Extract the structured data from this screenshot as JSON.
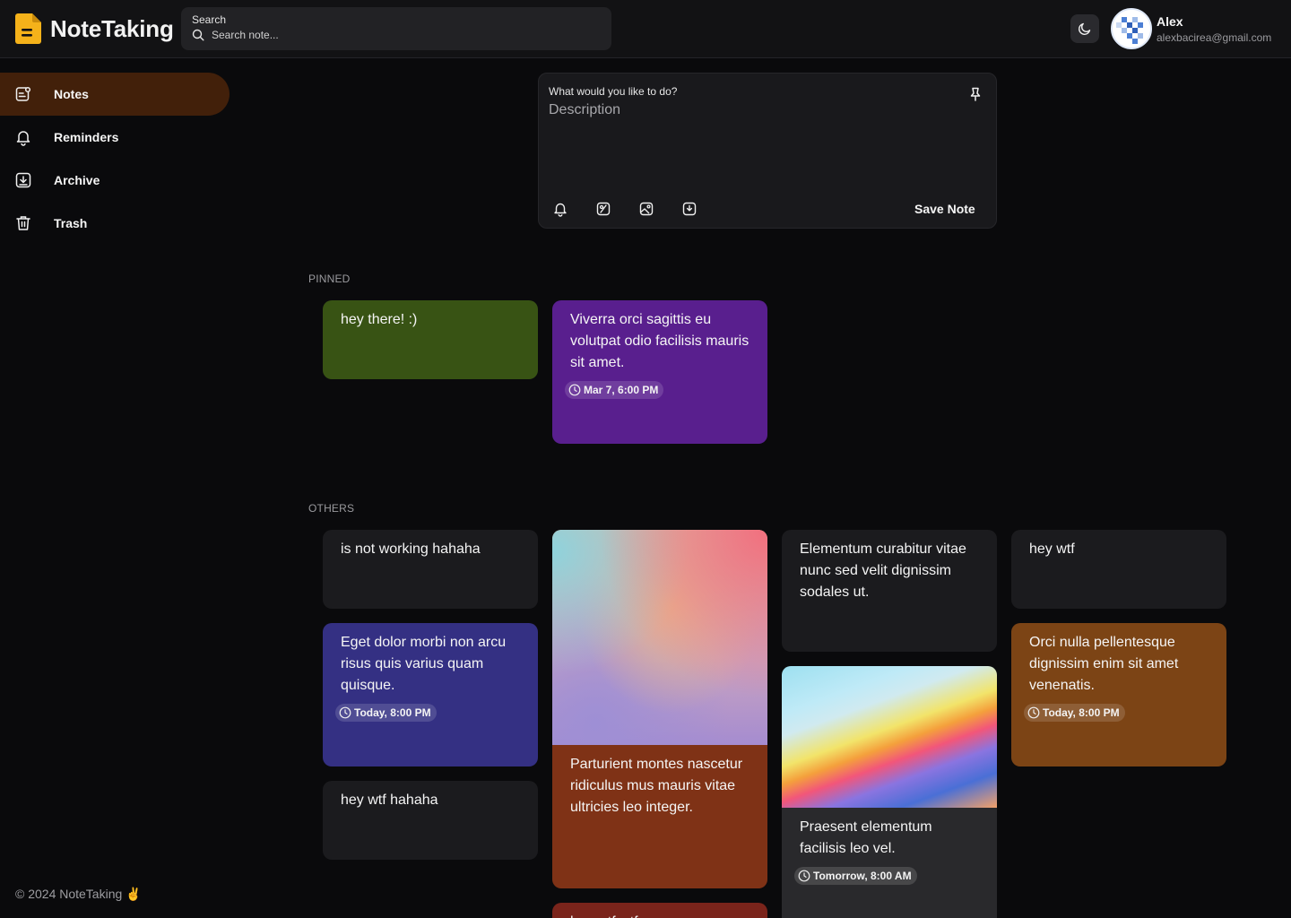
{
  "app": {
    "name": "NoteTaking",
    "footer": "© 2024 NoteTaking ✌️"
  },
  "header": {
    "search_label": "Search",
    "search_placeholder": "Search note...",
    "theme_icon": "moon-icon",
    "user": {
      "name": "Alex",
      "email": "alexbacirea@gmail.com"
    }
  },
  "sidebar": {
    "items": [
      {
        "label": "Notes",
        "icon": "notes-icon",
        "active": true
      },
      {
        "label": "Reminders",
        "icon": "bell-icon",
        "active": false
      },
      {
        "label": "Archive",
        "icon": "archive-icon",
        "active": false
      },
      {
        "label": "Trash",
        "icon": "trash-icon",
        "active": false
      }
    ]
  },
  "composer": {
    "title_placeholder": "What would you like to do?",
    "description_placeholder": "Description",
    "save_label": "Save Note",
    "tools": [
      "bell-icon",
      "palette-icon",
      "image-icon",
      "archive-icon"
    ]
  },
  "sections": {
    "pinned": "PINNED",
    "others": "OTHERS"
  },
  "notes": {
    "pinned": [
      {
        "text": "hey there! :)",
        "color": "#385314"
      },
      {
        "text": "Viverra orci sagittis eu volutpat odio facilisis mauris sit amet.",
        "reminder": "Mar 7, 6:00 PM",
        "color": "#591f8e"
      }
    ],
    "others": [
      {
        "text": "is not working hahaha",
        "color": "#1b1b1e"
      },
      {
        "text": "Eget dolor morbi non arcu risus quis varius quam quisque.",
        "reminder": "Today, 8:00 PM",
        "color": "#343083"
      },
      {
        "text": "hey wtf hahaha",
        "color": "#1b1b1e"
      },
      {
        "text": "Parturient montes nascetur ridiculus mus mauris vitae ultricies leo integer.",
        "color": "#7f3216",
        "has_image": true
      },
      {
        "text": "hey wtf wtf",
        "color": "#7a241b"
      },
      {
        "text": "Elementum curabitur vitae nunc sed velit dignissim sodales ut.",
        "color": "#1b1b1e"
      },
      {
        "text": "Praesent elementum facilisis leo vel.",
        "reminder": "Tomorrow, 8:00 AM",
        "color": "#1b1b1e",
        "has_image": true
      },
      {
        "text": "hey wtf",
        "color": "#1b1b1e"
      },
      {
        "text": "Orci nulla pellentesque dignissim enim sit amet venenatis.",
        "reminder": "Today, 8:00 PM",
        "color": "#7c4415"
      }
    ]
  }
}
